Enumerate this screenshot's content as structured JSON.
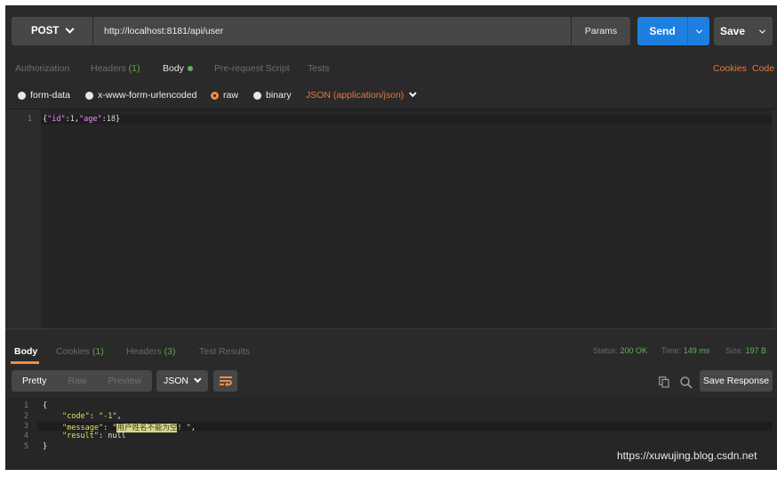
{
  "request": {
    "method": "POST",
    "url": "http://localhost:8181/api/user",
    "params_label": "Params",
    "send_label": "Send",
    "save_label": "Save"
  },
  "request_tabs": {
    "authorization": "Authorization",
    "headers": "Headers",
    "headers_count": "(1)",
    "body": "Body",
    "prerequest": "Pre-request Script",
    "tests": "Tests",
    "cookies": "Cookies",
    "code": "Code"
  },
  "body_types": {
    "form_data": "form-data",
    "urlencoded": "x-www-form-urlencoded",
    "raw": "raw",
    "binary": "binary",
    "selected": "raw",
    "content_type": "JSON (application/json)"
  },
  "request_body": {
    "line_numbers": [
      "1"
    ],
    "open_brace": "{",
    "key1": "\"id\"",
    "val1": "1",
    "key2": "\"age\"",
    "val2": "18",
    "close_brace": "}"
  },
  "response_tabs": {
    "body": "Body",
    "cookies": "Cookies",
    "cookies_count": "(1)",
    "headers": "Headers",
    "headers_count": "(3)",
    "test_results": "Test Results",
    "status_label": "Status:",
    "status_value": "200 OK",
    "time_label": "Time:",
    "time_value": "149 ms",
    "size_label": "Size:",
    "size_value": "197 B"
  },
  "response_toolbar": {
    "pretty": "Pretty",
    "raw": "Raw",
    "preview": "Preview",
    "format": "JSON",
    "save_response": "Save Response"
  },
  "response_body": {
    "line_numbers": [
      "1",
      "2",
      "3",
      "4",
      "5"
    ],
    "l1": "{",
    "code_key": "\"code\"",
    "code_val": "\"-1\"",
    "message_key": "\"message\"",
    "message_open": "\"",
    "message_selected": "用户姓名不能为空",
    "message_rest": "! \"",
    "result_key": "\"result\"",
    "result_val": "null",
    "l5": "}"
  },
  "watermark": "https://xuwujing.blog.csdn.net",
  "colors": {
    "accent_orange": "#f08c43",
    "send_blue": "#1d7fe0",
    "status_green": "#5fb35a"
  }
}
